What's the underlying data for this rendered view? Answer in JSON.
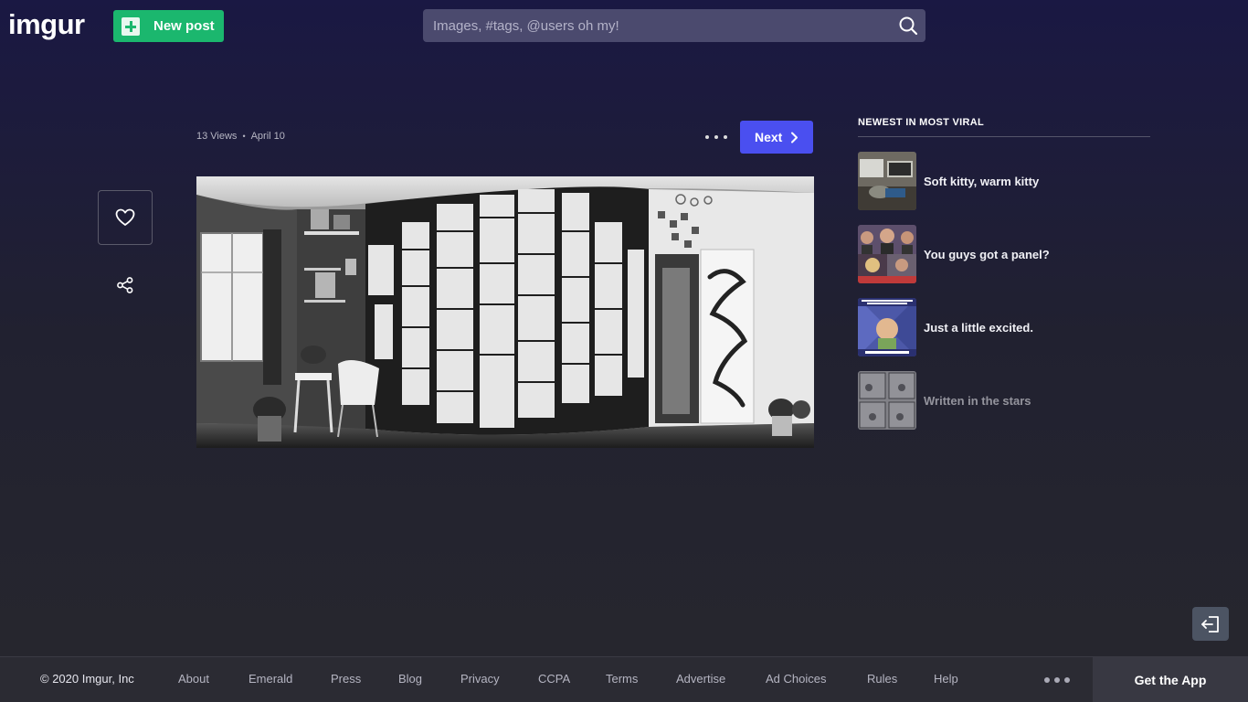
{
  "header": {
    "logo": "imgur",
    "new_post_label": "New post",
    "search_placeholder": "Images, #tags, @users oh my!"
  },
  "post": {
    "views": "13 Views",
    "separator": "•",
    "date": "April 10",
    "next_label": "Next"
  },
  "sidebar": {
    "title": "NEWEST IN MOST VIRAL",
    "items": [
      {
        "title": "Soft kitty, warm kitty"
      },
      {
        "title": "You guys got a panel?"
      },
      {
        "title": "Just a little excited."
      },
      {
        "title": "Written in the stars"
      }
    ]
  },
  "footer": {
    "copyright": "© 2020 Imgur, Inc",
    "links": [
      "About",
      "Emerald",
      "Press",
      "Blog",
      "Privacy",
      "CCPA",
      "Terms",
      "Advertise",
      "Ad Choices",
      "Rules",
      "Help"
    ],
    "get_app": "Get the App"
  },
  "colors": {
    "brand_green": "#1bb76e",
    "next_blue": "#4a4ff0",
    "header_bg": "#1a1843"
  },
  "icons": [
    "search-icon",
    "heart-icon",
    "share-icon",
    "chevron-right-icon",
    "more-icon",
    "sign-in-icon",
    "plus-icon"
  ]
}
